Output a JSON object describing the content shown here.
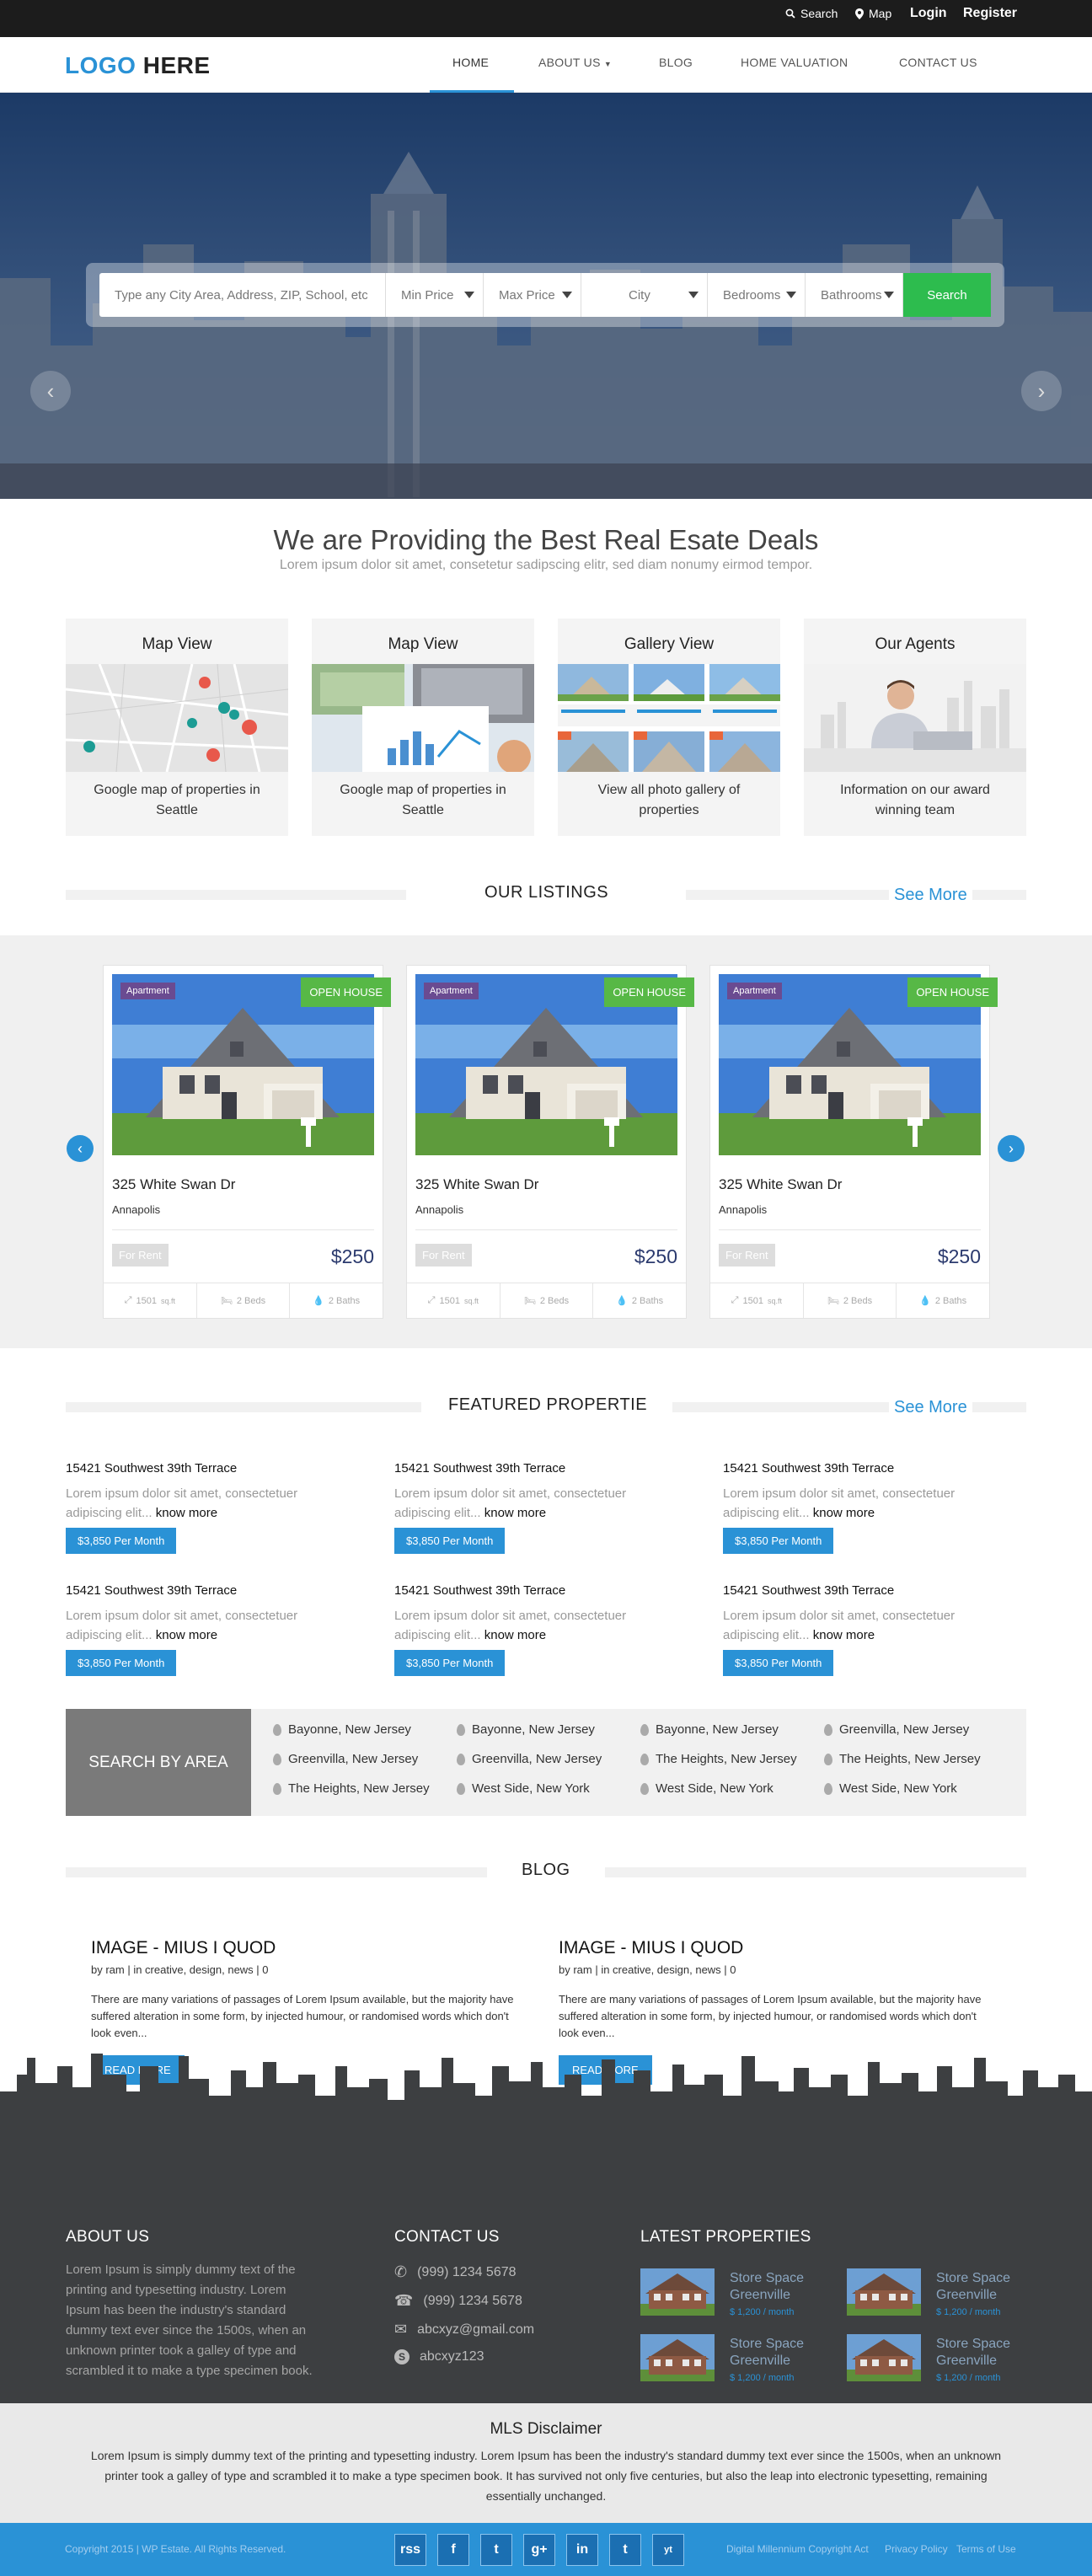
{
  "topbar": {
    "search": "Search",
    "map": "Map",
    "login": "Login",
    "register": "Register"
  },
  "nav": {
    "logo_a": "LOGO",
    "logo_b": "HERE",
    "items": [
      "HOME",
      "ABOUT US",
      "BLOG",
      "HOME VALUATION",
      "CONTACT US"
    ]
  },
  "search": {
    "placeholder": "Type any City Area, Address, ZIP, School, etc",
    "min_price": "Min Price",
    "max_price": "Max Price",
    "city": "City",
    "bedrooms": "Bedrooms",
    "bathrooms": "Bathrooms",
    "button": "Search"
  },
  "intro": {
    "title": "We are Providing the Best Real Esate Deals",
    "subtitle": "Lorem ipsum dolor sit amet, consetetur sadipscing elitr, sed diam nonumy eirmod tempor."
  },
  "features": [
    {
      "title": "Map View",
      "desc": "Google map of properties in Seattle"
    },
    {
      "title": "Map View",
      "desc": "Google map of properties in Seattle"
    },
    {
      "title": "Gallery View",
      "desc": "View all photo gallery of properties"
    },
    {
      "title": "Our Agents",
      "desc": "Information on our award winning team"
    }
  ],
  "listings": {
    "title": "OUR LISTINGS",
    "see_more": "See More",
    "items": [
      {
        "type": "Apartment",
        "status": "OPEN HOUSE",
        "address": "325 White Swan Dr",
        "city": "Annapolis",
        "tag": "For Rent",
        "price": "$250",
        "size": "1501",
        "size_unit": "sq.ft",
        "beds": "2 Beds",
        "baths": "2 Baths"
      },
      {
        "type": "Apartment",
        "status": "OPEN HOUSE",
        "address": "325 White Swan Dr",
        "city": "Annapolis",
        "tag": "For Rent",
        "price": "$250",
        "size": "1501",
        "size_unit": "sq.ft",
        "beds": "2 Beds",
        "baths": "2 Baths"
      },
      {
        "type": "Apartment",
        "status": "OPEN HOUSE",
        "address": "325 White Swan Dr",
        "city": "Annapolis",
        "tag": "For Rent",
        "price": "$250",
        "size": "1501",
        "size_unit": "sq.ft",
        "beds": "2 Beds",
        "baths": "2 Baths"
      }
    ]
  },
  "featured": {
    "title": "FEATURED PROPERTIE",
    "see_more": "See More",
    "items": [
      {
        "title": "15421 Southwest 39th Terrace",
        "desc": "Lorem ipsum dolor sit amet, consectetuer adipiscing elit...",
        "more": "know more",
        "price": "$3,850 Per Month"
      },
      {
        "title": "15421 Southwest 39th Terrace",
        "desc": "Lorem ipsum dolor sit amet, consectetuer adipiscing elit...",
        "more": "know more",
        "price": "$3,850 Per Month"
      },
      {
        "title": "15421 Southwest 39th Terrace",
        "desc": "Lorem ipsum dolor sit amet, consectetuer adipiscing elit...",
        "more": "know more",
        "price": "$3,850 Per Month"
      },
      {
        "title": "15421 Southwest 39th Terrace",
        "desc": "Lorem ipsum dolor sit amet, consectetuer adipiscing elit...",
        "more": "know more",
        "price": "$3,850 Per Month"
      },
      {
        "title": "15421 Southwest 39th Terrace",
        "desc": "Lorem ipsum dolor sit amet, consectetuer adipiscing elit...",
        "more": "know more",
        "price": "$3,850 Per Month"
      },
      {
        "title": "15421 Southwest 39th Terrace",
        "desc": "Lorem ipsum dolor sit amet, consectetuer adipiscing elit...",
        "more": "know more",
        "price": "$3,850 Per Month"
      }
    ]
  },
  "areas": {
    "label": "SEARCH BY AREA",
    "items": [
      "Bayonne, New Jersey",
      "Bayonne, New Jersey",
      "Bayonne, New Jersey",
      "Greenvilla, New Jersey",
      "Greenvilla, New Jersey",
      "Greenvilla, New Jersey",
      "The Heights, New Jersey",
      "The Heights, New Jersey",
      "The Heights, New Jersey",
      "West Side, New York",
      "West Side, New York",
      "West Side, New York"
    ]
  },
  "blog": {
    "title": "BLOG",
    "posts": [
      {
        "title": "IMAGE - MIUS I QUOD",
        "meta": "by ram | in creative, design, news | 0",
        "desc": "There are many variations of passages of Lorem Ipsum available, but the majority have suffered alteration in some form, by injected humour, or randomised words which don't look even...",
        "button": "READ MORE"
      },
      {
        "title": "IMAGE - MIUS I QUOD",
        "meta": "by ram | in creative, design, news | 0",
        "desc": "There are many variations of passages of Lorem Ipsum available, but the majority have suffered alteration in some form, by injected humour, or randomised words which don't look even...",
        "button": "READ MORE"
      }
    ]
  },
  "footer": {
    "about_title": "ABOUT US",
    "about_text": "Lorem Ipsum is simply dummy text of the printing and typesetting industry. Lorem Ipsum has been the industry's standard dummy text ever since the 1500s, when an unknown printer took a galley of type and scrambled it to make a type specimen book.",
    "contact_title": "CONTACT US",
    "phone1": "(999) 1234 5678",
    "phone2": "(999) 1234 5678",
    "email": "abcxyz@gmail.com",
    "skype": "abcxyz123",
    "latest_title": "LATEST PROPERTIES",
    "latest": [
      {
        "name": "Store Space Greenville",
        "price": "$ 1,200 / month"
      },
      {
        "name": "Store Space Greenville",
        "price": "$ 1,200 / month"
      },
      {
        "name": "Store Space Greenville",
        "price": "$ 1,200 / month"
      },
      {
        "name": "Store Space Greenville",
        "price": "$ 1,200 / month"
      }
    ]
  },
  "disclaimer": {
    "title": "MLS Disclaimer",
    "text": "Lorem Ipsum is simply dummy text of the printing and typesetting industry. Lorem Ipsum has been the industry's standard dummy text ever since the 1500s, when an unknown printer took a galley of type and scrambled it to make a type specimen book. It has survived not only five centuries, but also the leap into electronic typesetting, remaining essentially unchanged."
  },
  "bottom": {
    "copyright": "Copyright 2015 | WP Estate. All Rights Reserved.",
    "social": [
      "rss",
      "f",
      "t",
      "g+",
      "in",
      "t",
      "yt"
    ],
    "link1": "Digital Millennium Copyright Act",
    "link2": "Privacy Policy",
    "link3": "Terms of Use"
  },
  "colors": {
    "accent": "#2a92d6",
    "green": "#2dbc4e",
    "open_house": "#57b846",
    "badge": "#6a4b91",
    "footer": "#3d3f41"
  }
}
